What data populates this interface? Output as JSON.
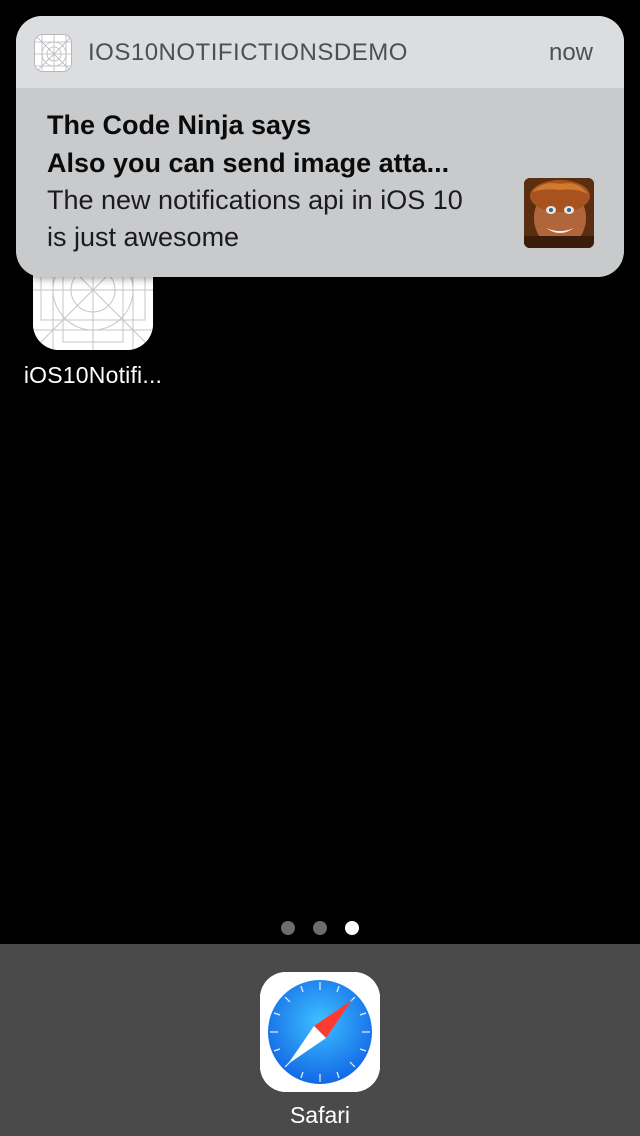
{
  "home_screen": {
    "app": {
      "label": "iOS10Notifi...",
      "icon": "app-placeholder-grid-icon"
    }
  },
  "notification": {
    "app_name": "IOS10NOTIFICTIONSDEMO",
    "time": "now",
    "title": "The Code Ninja says",
    "subtitle": "Also you can send image atta...",
    "message": "The new notifications api in iOS 10 is just awesome",
    "app_icon": "app-placeholder-grid-icon",
    "attachment": "image-attachment-thumbnail"
  },
  "page_indicator": {
    "total": 3,
    "current": 3
  },
  "dock": {
    "apps": [
      {
        "label": "Safari",
        "icon": "safari-compass-icon"
      }
    ]
  },
  "colors": {
    "background": "#000000",
    "notification_body": "#c8cacc",
    "notification_header": "#dcdddf",
    "dock": "#4a4a4b",
    "safari_blue": "#1e8ef0",
    "safari_red": "#ff3b30"
  }
}
